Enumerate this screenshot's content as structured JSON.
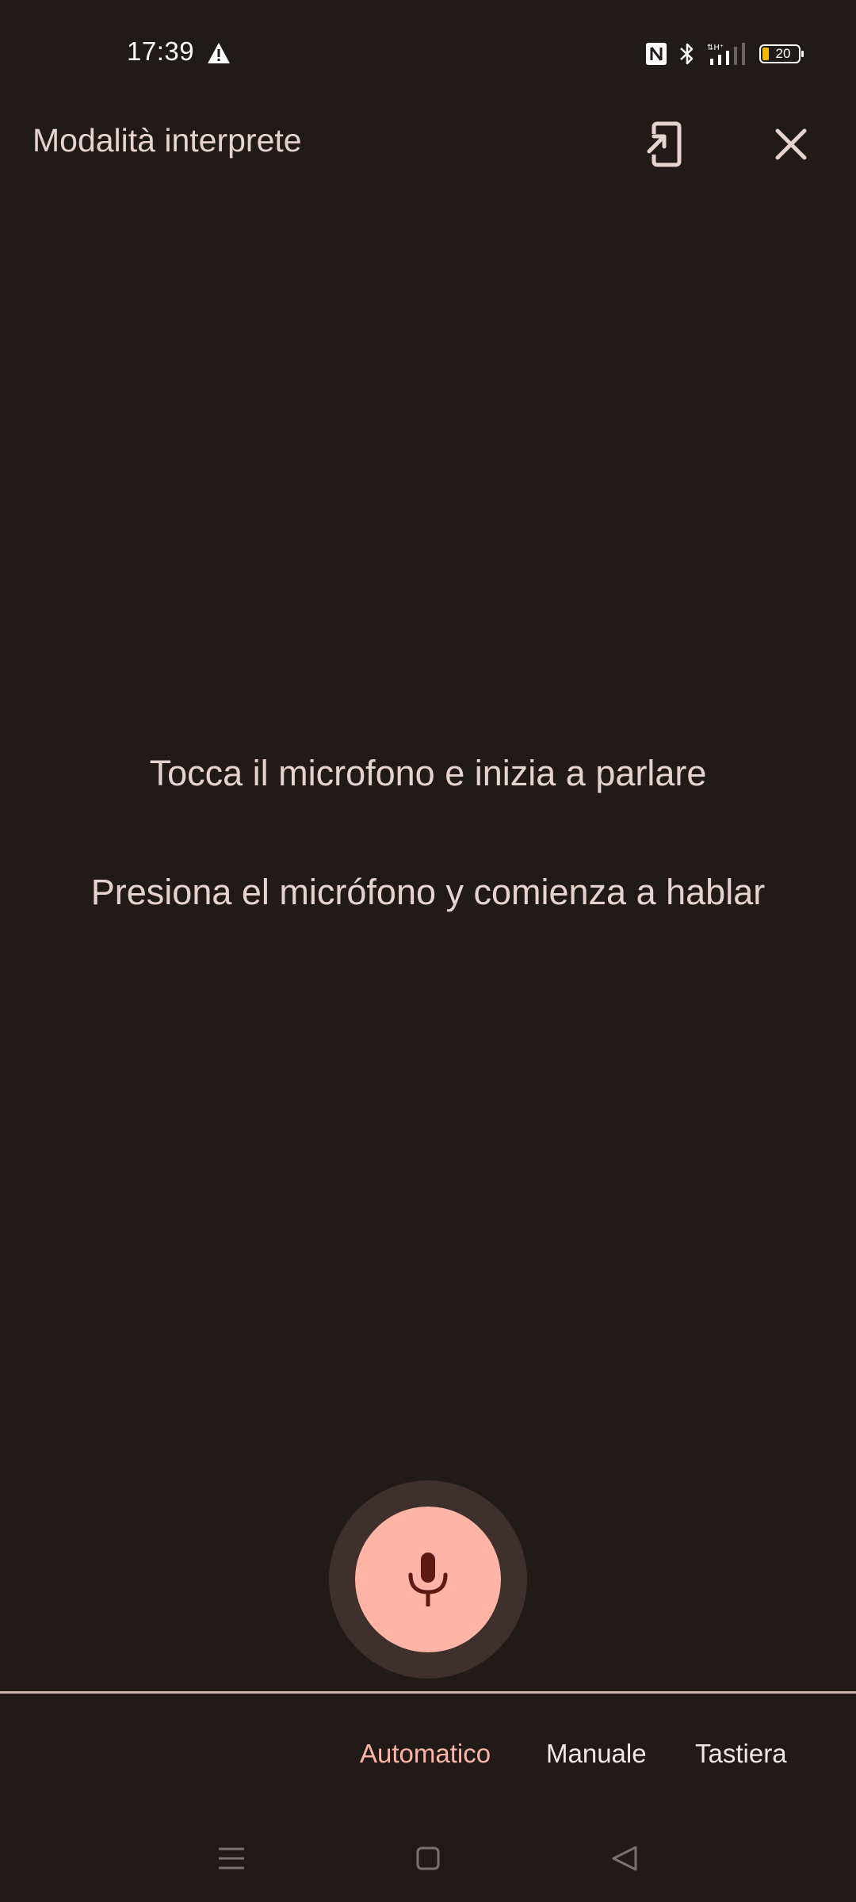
{
  "status_bar": {
    "time": "17:39",
    "battery_level": "20",
    "icons": [
      "warning-icon",
      "nfc-icon",
      "bluetooth-icon",
      "signal-icon",
      "battery-icon"
    ]
  },
  "header": {
    "title": "Modalità interprete",
    "icons": [
      "open-in-phone-icon",
      "close-icon"
    ]
  },
  "prompts": {
    "italian": "Tocca il microfono e inizia a parlare",
    "spanish": "Presiona el micrófono y comienza a hablar"
  },
  "mic": {
    "icon": "microphone-icon"
  },
  "modes": {
    "selected": "Automatico",
    "items": [
      "Automatico",
      "Manuale",
      "Tastiera"
    ]
  },
  "navigation": {
    "icons": [
      "menu-icon",
      "home-icon",
      "back-icon"
    ]
  },
  "colors": {
    "background": "#201a18",
    "accent": "#ffb4a6",
    "text": "#e6d3cf",
    "mic_ring": "#3d302d"
  }
}
